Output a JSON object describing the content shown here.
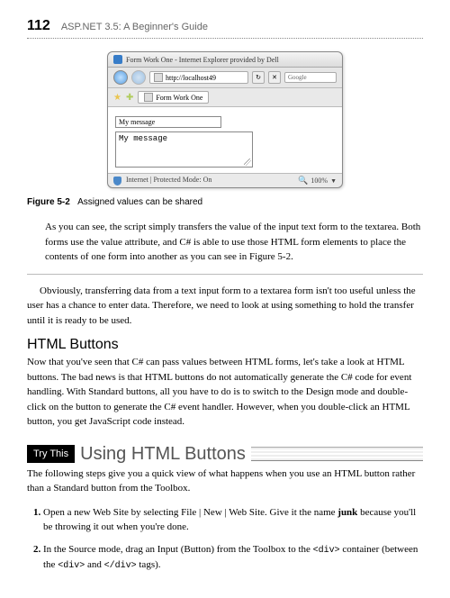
{
  "header": {
    "page_number": "112",
    "book_title": "ASP.NET 3.5: A Beginner's Guide"
  },
  "browser": {
    "window_title": "Form Work One - Internet Explorer provided by Dell",
    "url": "http://localhost49",
    "search_placeholder": "Google",
    "go_label": "→",
    "cross_label": "✕",
    "tab_title": "Form Work One",
    "input_value": "My message",
    "textarea_value": "My message",
    "status_text": "Internet | Protected Mode: On",
    "zoom_text": "100%"
  },
  "figure": {
    "label": "Figure 5-2",
    "caption": "Assigned values can be shared"
  },
  "para1": "As you can see, the script simply transfers the value of the input text form to the textarea. Both forms use the value attribute, and C# is able to use those HTML form elements to place the contents of one form into another as you can see in Figure 5-2.",
  "para2": "Obviously, transferring data from a text input form to a textarea form isn't too useful unless the user has a chance to enter data. Therefore, we need to look at using something to hold the transfer until it is ready to be used.",
  "section1": {
    "heading": "HTML Buttons",
    "text": "Now that you've seen that C# can pass values between HTML forms, let's take a look at HTML buttons. The bad news is that HTML buttons do not automatically generate the C# code for event handling. With Standard buttons, all you have to do is to switch to the Design mode and double-click on the button to generate the C# event handler. However, when you double-click an HTML button, you get JavaScript code instead."
  },
  "trythis": {
    "badge": "Try This",
    "heading": "Using HTML Buttons",
    "intro": "The following steps give you a quick view of what happens when you use an HTML button rather than a Standard button from the Toolbox.",
    "step1_a": "Open a new Web Site by selecting File | New | Web Site. Give it the name ",
    "step1_bold": "junk",
    "step1_b": " because you'll be throwing it out when you're done.",
    "step2_a": "In the Source mode, drag an Input (Button) from the Toolbox to the ",
    "step2_code1": "<div>",
    "step2_b": " container (between the ",
    "step2_code2": "<div>",
    "step2_c": " and ",
    "step2_code3": "</div>",
    "step2_d": " tags)."
  }
}
